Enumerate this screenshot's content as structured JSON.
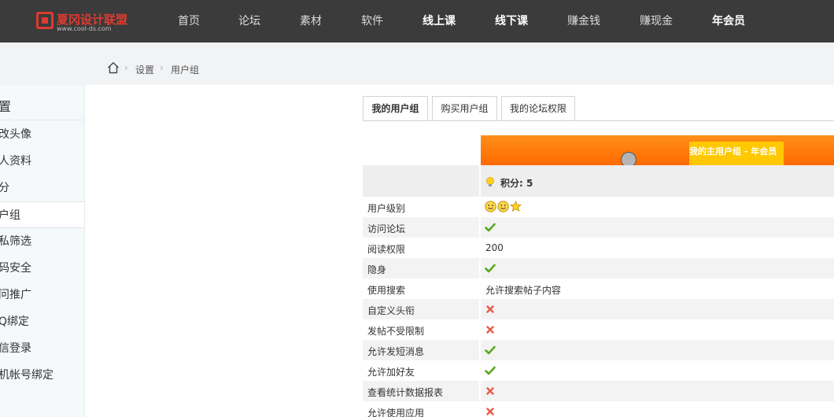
{
  "header": {
    "logo_name": "夏冈设计联盟",
    "logo_url": "www.cool-ds.com",
    "nav": [
      {
        "label": "首页",
        "bold": false
      },
      {
        "label": "论坛",
        "bold": false
      },
      {
        "label": "素材",
        "bold": false
      },
      {
        "label": "软件",
        "bold": false
      },
      {
        "label": "线上课",
        "bold": true
      },
      {
        "label": "线下课",
        "bold": true
      },
      {
        "label": "赚金钱",
        "bold": false
      },
      {
        "label": "赚现金",
        "bold": false
      },
      {
        "label": "年会员",
        "bold": true
      }
    ]
  },
  "breadcrumb": {
    "items": [
      "设置",
      "用户组"
    ]
  },
  "sidebar": {
    "title": "置",
    "items": [
      "改头像",
      "人资料",
      "分",
      "户组",
      "私筛选",
      "码安全",
      "问推广",
      "Q绑定",
      "信登录",
      "机帐号绑定"
    ],
    "active_index": 3
  },
  "tabs": [
    "我的用户组",
    "购买用户组",
    "我的论坛权限"
  ],
  "group": {
    "header_label": "我的主用户组 - 年会员",
    "score_label": "积分: 5",
    "rows": [
      {
        "label": "用户级别",
        "type": "icons"
      },
      {
        "label": "访问论坛",
        "type": "check"
      },
      {
        "label": "阅读权限",
        "type": "text",
        "value": "200"
      },
      {
        "label": "隐身",
        "type": "check"
      },
      {
        "label": "使用搜索",
        "type": "text",
        "value": "允许搜索帖子内容"
      },
      {
        "label": "自定义头衔",
        "type": "cross"
      },
      {
        "label": "发帖不受限制",
        "type": "cross"
      },
      {
        "label": "允许发短消息",
        "type": "check"
      },
      {
        "label": "允许加好友",
        "type": "check"
      },
      {
        "label": "查看统计数据报表",
        "type": "cross"
      },
      {
        "label": "允许使用应用",
        "type": "cross"
      }
    ]
  },
  "colors": {
    "topbar": "#3b3b3b",
    "accent_orange": "#ff7a00",
    "highlight_yellow": "#ffcc00",
    "check_green": "#5aa81e",
    "cross_red": "#e85b4a"
  }
}
